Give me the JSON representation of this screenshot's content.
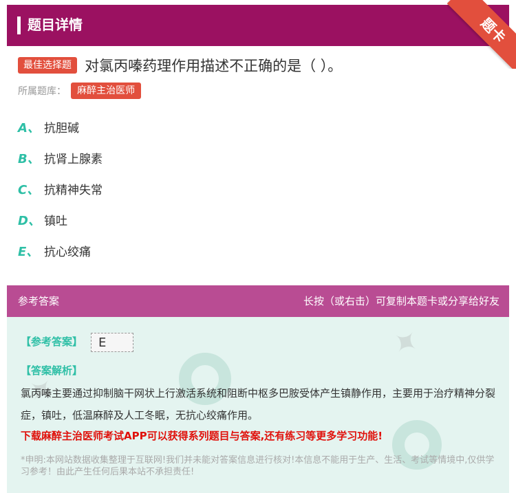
{
  "header": {
    "title": "题目详情",
    "ribbon": "题卡"
  },
  "question": {
    "badge": "最佳选择题",
    "text": "对氯丙嗪药理作用描述不正确的是（ ）。"
  },
  "source": {
    "label": "所属题库：",
    "tag": "麻醉主治医师"
  },
  "options": [
    {
      "letter": "A、",
      "text": "抗胆碱"
    },
    {
      "letter": "B、",
      "text": "抗肾上腺素"
    },
    {
      "letter": "C、",
      "text": "抗精神失常"
    },
    {
      "letter": "D、",
      "text": "镇吐"
    },
    {
      "letter": "E、",
      "text": "抗心绞痛"
    }
  ],
  "answer_header": {
    "left": "参考答案",
    "right": "长按（或右击）可复制本题卡或分享给好友"
  },
  "answer": {
    "label": "【参考答案】",
    "value": "E",
    "analysis_label": "【答案解析】",
    "analysis": "氯丙嗪主要通过抑制脑干网状上行激活系统和阻断中枢多巴胺受体产生镇静作用，主要用于治疗精神分裂症，镇吐，低温麻醉及人工冬眠，无抗心绞痛作用。",
    "promo": "下载麻醉主治医师考试APP可以获得系列题目与答案,还有练习等更多学习功能!",
    "disclaimer": "*申明:本网站数据收集整理于互联网!我们并未能对答案信息进行核对!本信息不能用于生产、生活、考试等情境中,仅供学习参考！由此产生任何后果本站不承担责任!"
  },
  "colors": {
    "header": "#9b1161",
    "accent": "#e24f3d",
    "option_letter": "#2ebfa6",
    "answer_header": "#b94c93",
    "answer_bg": "#e4f4f0",
    "promo": "#e0110b"
  }
}
